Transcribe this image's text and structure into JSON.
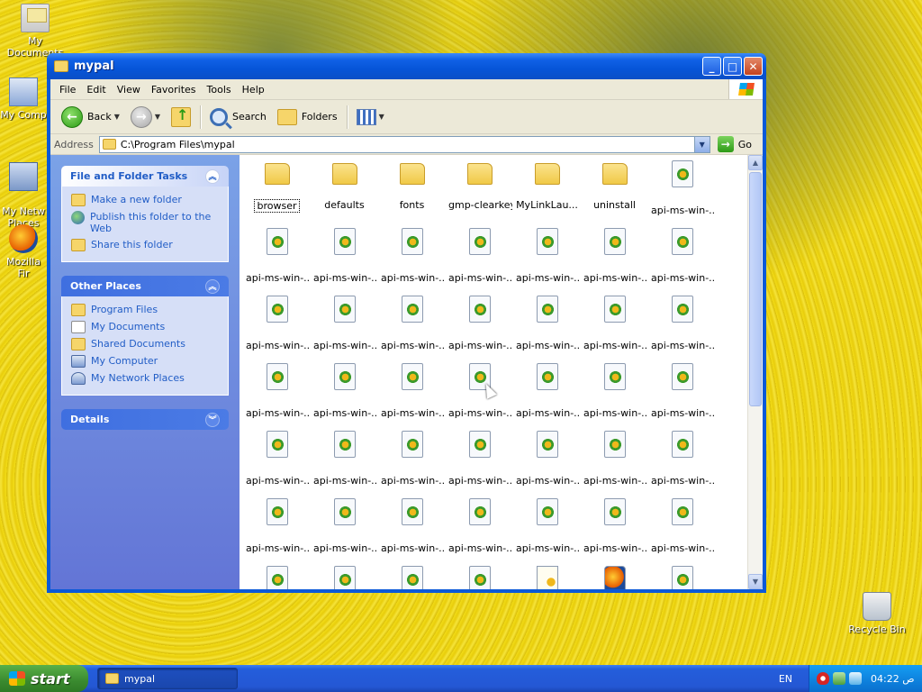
{
  "desktop": {
    "icons": [
      {
        "label": "My Documents",
        "icon": "my-documents-icon"
      },
      {
        "label": "My Comp",
        "icon": "my-computer-icon"
      },
      {
        "label": "My Netw\nPlaces",
        "icon": "network-places-icon"
      },
      {
        "label": "Mozilla Fir",
        "icon": "firefox-icon"
      },
      {
        "label": "Recycle Bin",
        "icon": "recycle-bin-icon"
      }
    ]
  },
  "window": {
    "title": "mypal",
    "controls": {
      "minimize": "_",
      "maximize": "□",
      "close": "✕"
    },
    "menu": [
      "File",
      "Edit",
      "View",
      "Favorites",
      "Tools",
      "Help"
    ],
    "toolbar": {
      "back": "Back",
      "search": "Search",
      "folders": "Folders"
    },
    "address": {
      "label": "Address",
      "value": "C:\\Program Files\\mypal",
      "go": "Go"
    },
    "taskpane": {
      "file_tasks": {
        "header": "File and Folder Tasks",
        "links": [
          "Make a new folder",
          "Publish this folder to the Web",
          "Share this folder"
        ]
      },
      "other_places": {
        "header": "Other Places",
        "links": [
          "Program Files",
          "My Documents",
          "Shared Documents",
          "My Computer",
          "My Network Places"
        ]
      },
      "details": {
        "header": "Details"
      }
    },
    "files": [
      {
        "name": "browser",
        "type": "folder"
      },
      {
        "name": "defaults",
        "type": "folder"
      },
      {
        "name": "fonts",
        "type": "folder"
      },
      {
        "name": "gmp-clearkey",
        "type": "folder"
      },
      {
        "name": "MyLinkLau...",
        "type": "folder"
      },
      {
        "name": "uninstall",
        "type": "folder"
      },
      {
        "name": "api-ms-win-...",
        "type": "dll"
      },
      {
        "name": "api-ms-win-...",
        "type": "dll"
      },
      {
        "name": "api-ms-win-...",
        "type": "dll"
      },
      {
        "name": "api-ms-win-...",
        "type": "dll"
      },
      {
        "name": "api-ms-win-...",
        "type": "dll"
      },
      {
        "name": "api-ms-win-...",
        "type": "dll"
      },
      {
        "name": "api-ms-win-...",
        "type": "dll"
      },
      {
        "name": "api-ms-win-...",
        "type": "dll"
      },
      {
        "name": "api-ms-win-...",
        "type": "dll"
      },
      {
        "name": "api-ms-win-...",
        "type": "dll"
      },
      {
        "name": "api-ms-win-...",
        "type": "dll"
      },
      {
        "name": "api-ms-win-...",
        "type": "dll"
      },
      {
        "name": "api-ms-win-...",
        "type": "dll"
      },
      {
        "name": "api-ms-win-...",
        "type": "dll"
      },
      {
        "name": "api-ms-win-...",
        "type": "dll"
      },
      {
        "name": "api-ms-win-...",
        "type": "dll"
      },
      {
        "name": "api-ms-win-...",
        "type": "dll"
      },
      {
        "name": "api-ms-win-...",
        "type": "dll"
      },
      {
        "name": "api-ms-win-...",
        "type": "dll"
      },
      {
        "name": "api-ms-win-...",
        "type": "dll"
      },
      {
        "name": "api-ms-win-...",
        "type": "dll"
      },
      {
        "name": "api-ms-win-...",
        "type": "dll"
      },
      {
        "name": "api-ms-win-...",
        "type": "dll"
      },
      {
        "name": "api-ms-win-...",
        "type": "dll"
      },
      {
        "name": "api-ms-win-...",
        "type": "dll"
      },
      {
        "name": "api-ms-win-...",
        "type": "dll"
      },
      {
        "name": "api-ms-win-...",
        "type": "dll"
      },
      {
        "name": "api-ms-win-...",
        "type": "dll"
      },
      {
        "name": "api-ms-win-...",
        "type": "dll"
      },
      {
        "name": "api-ms-win-...",
        "type": "dll"
      },
      {
        "name": "api-ms-win-...",
        "type": "dll"
      },
      {
        "name": "api-ms-win-...",
        "type": "dll"
      },
      {
        "name": "api-ms-win-...",
        "type": "dll"
      },
      {
        "name": "api-ms-win-...",
        "type": "dll"
      },
      {
        "name": "api-ms-win-...",
        "type": "dll"
      },
      {
        "name": "api-ms-win-...",
        "type": "dll"
      },
      {
        "name": "",
        "type": "dll"
      },
      {
        "name": "",
        "type": "dll"
      },
      {
        "name": "",
        "type": "dll"
      },
      {
        "name": "",
        "type": "dll"
      },
      {
        "name": "",
        "type": "ini"
      },
      {
        "name": "",
        "type": "exe"
      },
      {
        "name": "",
        "type": "dll"
      }
    ]
  },
  "taskbar": {
    "start": "start",
    "task": "mypal",
    "language": "EN",
    "clock": "04:22 ص"
  },
  "colors": {
    "title_blue": "#0a59d8",
    "taskpane_link": "#215dc6",
    "start_green": "#3a8a2f"
  }
}
